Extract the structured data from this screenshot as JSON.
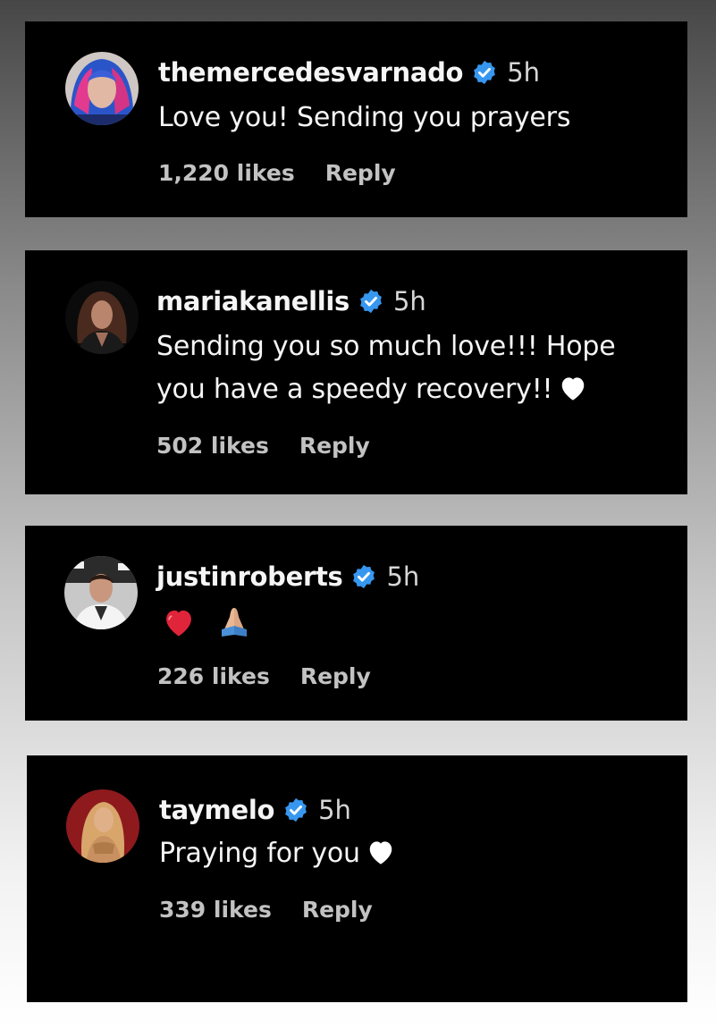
{
  "comments": [
    {
      "username": "themercedesvarnado",
      "time": "5h",
      "text_lines": [
        "Love you! Sending you prayers"
      ],
      "likes": "1,220 likes",
      "reply_label": "Reply",
      "avatar_icon": "avatar-photo-blue-hair",
      "verified_icon": "verified-badge-icon"
    },
    {
      "username": "mariakanellis",
      "time": "5h",
      "text_lines": [
        "Sending you so much love!!! Hope",
        "you have a speedy recovery!!"
      ],
      "trailing_icon": "white-heart-icon",
      "likes": "502 likes",
      "reply_label": "Reply",
      "avatar_icon": "avatar-photo-dark",
      "verified_icon": "verified-badge-icon"
    },
    {
      "username": "justinroberts",
      "time": "5h",
      "emojis": [
        "red-heart-icon",
        "folded-hands-icon"
      ],
      "likes": "226 likes",
      "reply_label": "Reply",
      "avatar_icon": "avatar-photo-man",
      "verified_icon": "verified-badge-icon"
    },
    {
      "username": "taymelo",
      "time": "5h",
      "text_lines": [
        "Praying for you"
      ],
      "trailing_icon": "white-heart-icon",
      "likes": "339 likes",
      "reply_label": "Reply",
      "avatar_icon": "avatar-photo-red",
      "verified_icon": "verified-badge-icon"
    }
  ],
  "colors": {
    "card_background": "#000000",
    "username": "#f5f5f5",
    "meta": "#c2c2c2",
    "verified_badge": "#3797f0",
    "red_heart": "#e0243a"
  }
}
